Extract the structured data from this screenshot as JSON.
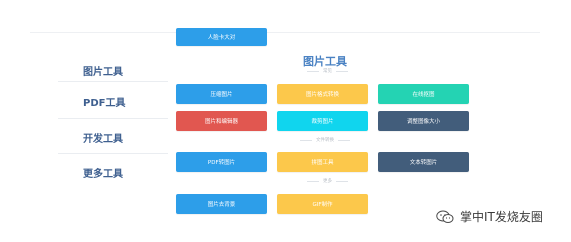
{
  "sidebar": {
    "items": [
      {
        "label": "图片工具"
      },
      {
        "label": "PDF工具"
      },
      {
        "label": "开发工具"
      },
      {
        "label": "更多工具"
      }
    ]
  },
  "main": {
    "title": "图片工具",
    "top_button": {
      "label": "人脸卡大对",
      "color": "#2d9ee9"
    },
    "subheadings": [
      "常见",
      "文件转换",
      "更多"
    ],
    "buttons": [
      {
        "label": "压缩图片",
        "color": "#2d9ee9"
      },
      {
        "label": "图片格式转换",
        "color": "#fcc84b"
      },
      {
        "label": "在线抠图",
        "color": "#24d3b3"
      },
      {
        "label": "图片和编辑器",
        "color": "#e15750"
      },
      {
        "label": "裁剪图片",
        "color": "#10d5ee"
      },
      {
        "label": "调整图像大小",
        "color": "#425d7b"
      },
      {
        "label": "PDF转图片",
        "color": "#2d9ee9"
      },
      {
        "label": "拼图工具",
        "color": "#fcc84b"
      },
      {
        "label": "文本转图片",
        "color": "#425d7b"
      },
      {
        "label": "图片去背景",
        "color": "#2d9ee9"
      },
      {
        "label": "GIF制作",
        "color": "#fcc84b"
      }
    ]
  },
  "watermark": {
    "text": "掌中IT发烧友圈",
    "icon": "wechat-icon"
  }
}
